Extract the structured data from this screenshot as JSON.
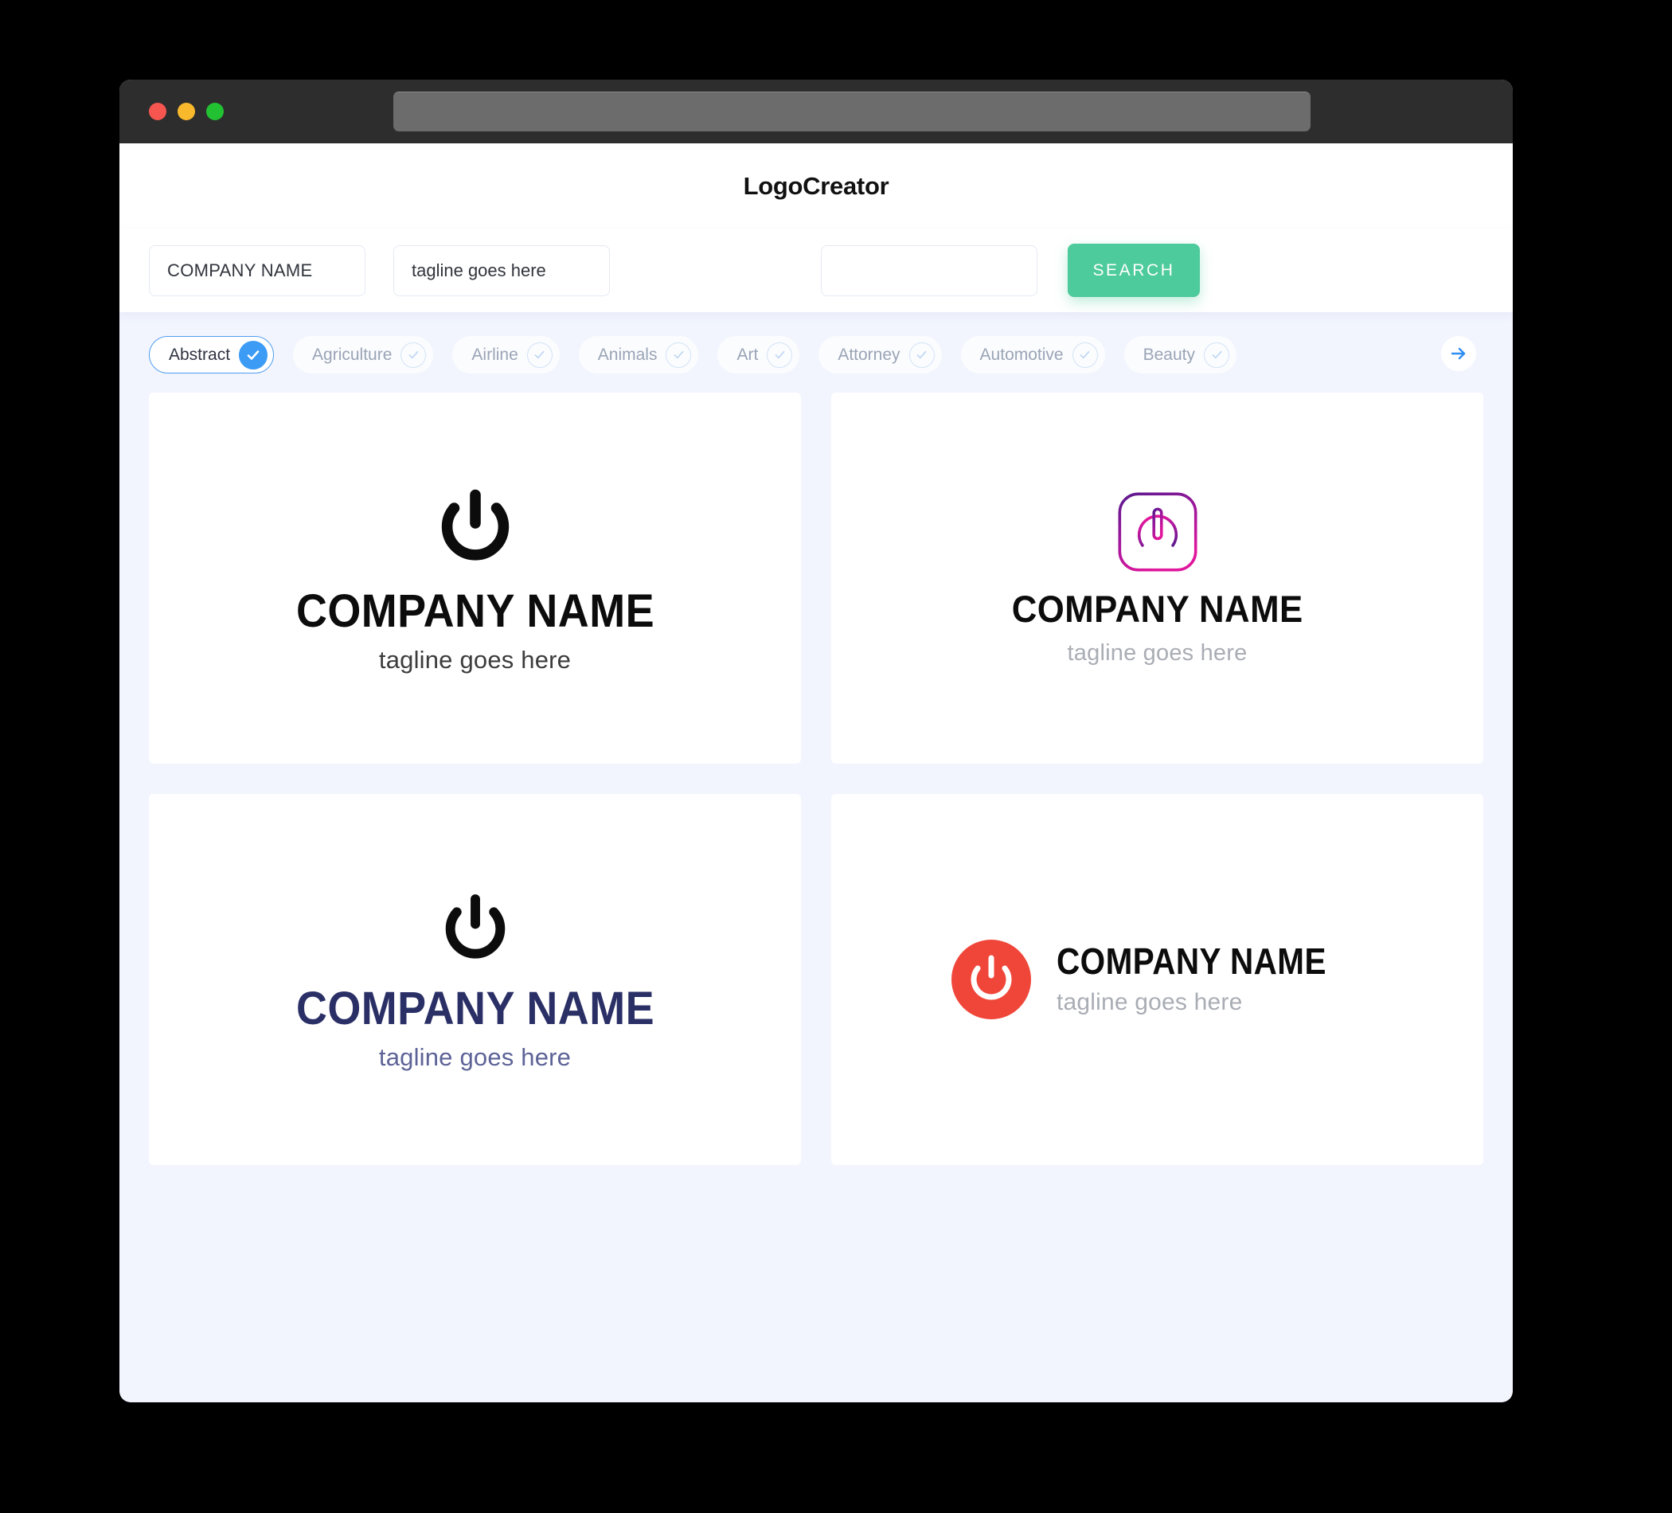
{
  "window": {
    "traffic_lights": [
      {
        "name": "close",
        "color": "#f6564f"
      },
      {
        "name": "minimize",
        "color": "#f8b92d"
      },
      {
        "name": "maximize",
        "color": "#22c132"
      }
    ],
    "url_value": ""
  },
  "header": {
    "title": "LogoCreator"
  },
  "search": {
    "company_value": "COMPANY NAME",
    "company_placeholder": "COMPANY NAME",
    "tagline_value": "tagline goes here",
    "tagline_placeholder": "tagline goes here",
    "keyword_value": "",
    "keyword_placeholder": "",
    "button_label": "SEARCH",
    "button_color": "#4ecb9c"
  },
  "categories": {
    "active_color": "#3b9bf5",
    "next_arrow": "→",
    "items": [
      {
        "label": "Abstract",
        "selected": true
      },
      {
        "label": "Agriculture",
        "selected": false
      },
      {
        "label": "Airline",
        "selected": false
      },
      {
        "label": "Animals",
        "selected": false
      },
      {
        "label": "Art",
        "selected": false
      },
      {
        "label": "Attorney",
        "selected": false
      },
      {
        "label": "Automotive",
        "selected": false
      },
      {
        "label": "Beauty",
        "selected": false
      }
    ]
  },
  "results": {
    "cards": [
      {
        "id": "logo-card-1",
        "icon": "power-icon",
        "layout": "stacked",
        "name": "COMPANY NAME",
        "tagline": "tagline goes here",
        "icon_color": "#0c0c0c",
        "name_color": "#0c0c0c",
        "tagline_color": "#3c3c3c"
      },
      {
        "id": "logo-card-2",
        "icon": "power-icon-rounded-square",
        "layout": "stacked",
        "name": "COMPANY NAME",
        "tagline": "tagline goes here",
        "icon_gradient_start": "#5b1a8e",
        "icon_gradient_end": "#e0179c",
        "name_color": "#0c0c0c",
        "tagline_color": "#a9adb4"
      },
      {
        "id": "logo-card-3",
        "icon": "power-icon",
        "layout": "stacked",
        "name": "COMPANY NAME",
        "tagline": "tagline goes here",
        "icon_color": "#0c0c0c",
        "name_color": "#2a2f66",
        "tagline_color": "#5d6397"
      },
      {
        "id": "logo-card-4",
        "icon": "power-icon-filled-circle",
        "layout": "horizontal",
        "name": "COMPANY NAME",
        "tagline": "tagline goes here",
        "icon_color": "#f0463a",
        "icon_glyph_color": "#ffffff",
        "name_color": "#0c0c0c",
        "tagline_color": "#a9adb4"
      }
    ]
  }
}
